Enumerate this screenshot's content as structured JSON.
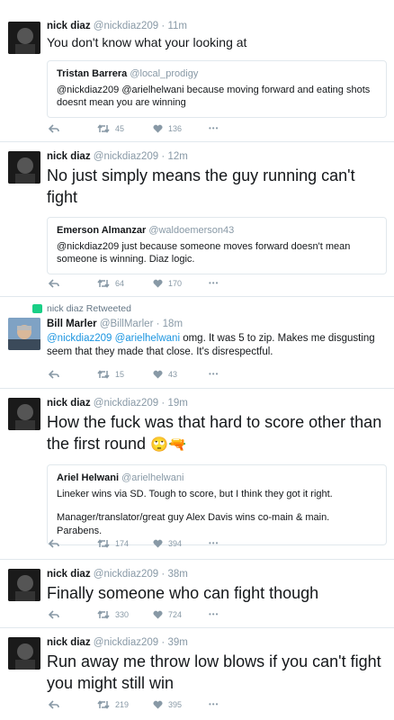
{
  "tweets": [
    {
      "name": "nick diaz",
      "handle": "@nickdiaz209",
      "time": "11m",
      "text": "You don't know what your looking at",
      "quote": {
        "name": "Tristan Barrera",
        "handle": "@local_prodigy",
        "text": "@nickdiaz209 @arielhelwani because moving forward and eating shots doesnt mean you are winning"
      },
      "retweets": "45",
      "likes": "136"
    },
    {
      "name": "nick diaz",
      "handle": "@nickdiaz209",
      "time": "12m",
      "text": "No just simply means the guy running can't fight",
      "quote": {
        "name": "Emerson Almanzar",
        "handle": "@waldoemerson43",
        "text": "@nickdiaz209 just because someone moves forward doesn't mean someone is winning. Diaz logic."
      },
      "retweets": "64",
      "likes": "170"
    },
    {
      "retweeted_by": "nick diaz Retweeted",
      "name": "Bill Marler",
      "handle": "@BillMarler",
      "time": "18m",
      "text_mentions": "@nickdiaz209 @arielhelwani",
      "text_rest": " omg. It was 5 to zip.  Makes me disgusting seem that they made that close. It's disrespectful.",
      "retweets": "15",
      "likes": "43"
    },
    {
      "name": "nick diaz",
      "handle": "@nickdiaz209",
      "time": "19m",
      "text": "How the fuck was that hard to score other than the first round",
      "emoji": "🙄🔫",
      "quote": {
        "name": "Ariel Helwani",
        "handle": "@arielhelwani",
        "text": "Lineker wins via SD. Tough to score, but I think they got it right.",
        "text2": "Manager/translator/great guy Alex Davis wins co-main & main. Parabens."
      },
      "retweets": "174",
      "likes": "394"
    },
    {
      "name": "nick diaz",
      "handle": "@nickdiaz209",
      "time": "38m",
      "text": "Finally someone who can fight though",
      "retweets": "330",
      "likes": "724"
    },
    {
      "name": "nick diaz",
      "handle": "@nickdiaz209",
      "time": "39m",
      "text": "Run away me throw low blows if you can't fight you might still win",
      "retweets": "219",
      "likes": "395"
    }
  ],
  "sep": " · ",
  "more": "•••"
}
